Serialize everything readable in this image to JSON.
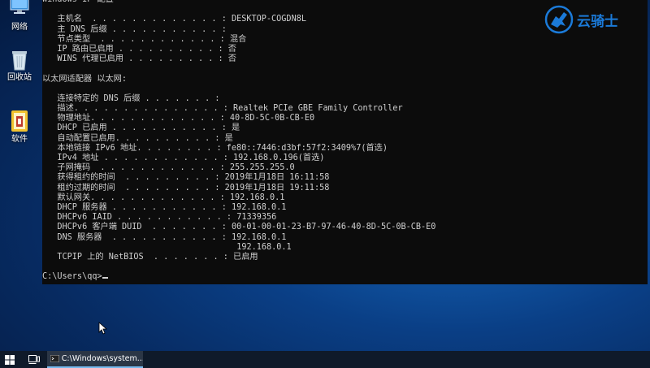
{
  "desktop": {
    "icons": [
      {
        "label": "网络",
        "icon": "network-icon"
      },
      {
        "label": "回收站",
        "icon": "recycle-bin-icon"
      },
      {
        "label": "软件",
        "icon": "software-folder-icon"
      }
    ]
  },
  "console": {
    "lines": [
      "Windows IP 配置",
      "",
      "   主机名  . . . . . . . . . . . . . : DESKTOP-COGDN8L",
      "   主 DNS 后缀 . . . . . . . . . . . :",
      "   节点类型  . . . . . . . . . . . . : 混合",
      "   IP 路由已启用 . . . . . . . . . . : 否",
      "   WINS 代理已启用 . . . . . . . . . : 否",
      "",
      "以太网适配器 以太网:",
      "",
      "   连接特定的 DNS 后缀 . . . . . . . :",
      "   描述. . . . . . . . . . . . . . . : Realtek PCIe GBE Family Controller",
      "   物理地址. . . . . . . . . . . . . : 40-8D-5C-0B-CB-E0",
      "   DHCP 已启用 . . . . . . . . . . . : 是",
      "   自动配置已启用. . . . . . . . . . : 是",
      "   本地链接 IPv6 地址. . . . . . . . : fe80::7446:d3bf:57f2:3409%7(首选)",
      "   IPv4 地址 . . . . . . . . . . . . : 192.168.0.196(首选)",
      "   子网掩码  . . . . . . . . . . . . : 255.255.255.0",
      "   获得租约的时间  . . . . . . . . . : 2019年1月18日 16:11:58",
      "   租约过期的时间  . . . . . . . . . : 2019年1月18日 19:11:58",
      "   默认网关. . . . . . . . . . . . . : 192.168.0.1",
      "   DHCP 服务器 . . . . . . . . . . . : 192.168.0.1",
      "   DHCPv6 IAID . . . . . . . . . . . : 71339356",
      "   DHCPv6 客户端 DUID  . . . . . . . : 00-01-00-01-23-B7-97-46-40-8D-5C-0B-CB-E0",
      "   DNS 服务器  . . . . . . . . . . . : 192.168.0.1",
      "                                       192.168.0.1",
      "   TCPIP 上的 NetBIOS  . . . . . . . : 已启用",
      ""
    ],
    "prompt": "C:\\Users\\qq>"
  },
  "watermark": {
    "text": "云骑士",
    "color": "#1b7ad8"
  },
  "taskbar": {
    "start_icon": "windows-logo-icon",
    "taskview_icon": "task-view-icon",
    "task_label": "C:\\Windows\\system..."
  }
}
